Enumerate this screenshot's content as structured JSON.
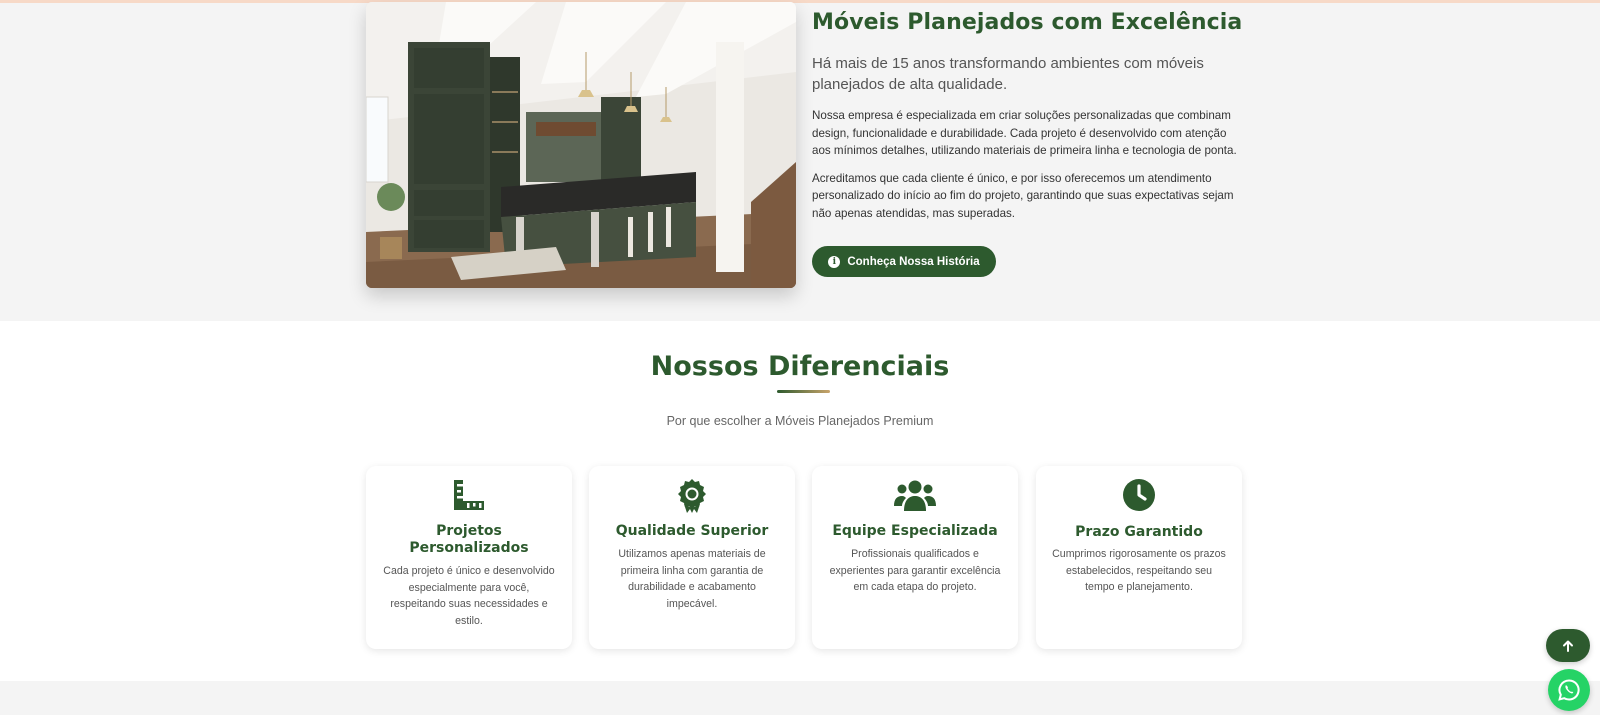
{
  "about": {
    "title": "Móveis Planejados com Excelência",
    "lead": "Há mais de 15 anos transformando ambientes com móveis planejados de alta qualidade.",
    "paragraph1": "Nossa empresa é especializada em criar soluções personalizadas que combinam design, funcionalidade e durabilidade. Cada projeto é desenvolvido com atenção aos mínimos detalhes, utilizando materiais de primeira linha e tecnologia de ponta.",
    "paragraph2": "Acreditamos que cada cliente é único, e por isso oferecemos um atendimento personalizado do início ao fim do projeto, garantindo que suas expectativas sejam não apenas atendidas, mas superadas.",
    "button_label": "Conheça Nossa História",
    "button_icon": "info-circle-icon",
    "image": "kitchen-photo"
  },
  "features": {
    "title": "Nossos Diferenciais",
    "subtitle": "Por que escolher a Móveis Planejados Premium",
    "cards": [
      {
        "icon": "ruler-combined-icon",
        "title": "Projetos Personalizados",
        "desc": "Cada projeto é único e desenvolvido especialmente para você, respeitando suas necessidades e estilo."
      },
      {
        "icon": "award-icon",
        "title": "Qualidade Superior",
        "desc": "Utilizamos apenas materiais de primeira linha com garantia de durabilidade e acabamento impecável."
      },
      {
        "icon": "users-icon",
        "title": "Equipe Especializada",
        "desc": "Profissionais qualificados e experientes para garantir excelência em cada etapa do projeto."
      },
      {
        "icon": "clock-icon",
        "title": "Prazo Garantido",
        "desc": "Cumprimos rigorosamente os prazos estabelecidos, respeitando seu tempo e planejamento."
      }
    ]
  },
  "floating": {
    "back_to_top_icon": "arrow-up-icon",
    "whatsapp_icon": "whatsapp-icon"
  },
  "colors": {
    "brand_green": "#2d5a2e",
    "accent_gold": "#c9a46b",
    "whatsapp_green": "#25d366",
    "section_gray": "#f4f4f4"
  }
}
